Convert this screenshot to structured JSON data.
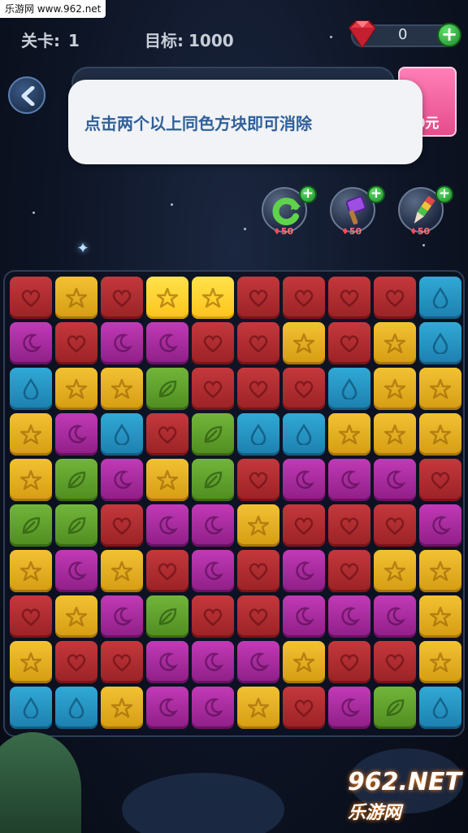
{
  "watermark_top": "乐游网 www.962.net",
  "header": {
    "level_label": "关卡:",
    "level_value": "1",
    "target_label": "目标:",
    "target_value": "1000",
    "gem_count": "0",
    "gem_add": "+"
  },
  "promo": {
    "price_text": "0元"
  },
  "tip": {
    "text": "点击两个以上同色方块即可消除"
  },
  "tools": [
    {
      "name": "refresh",
      "cost": "50",
      "plus": "+"
    },
    {
      "name": "hammer",
      "cost": "50",
      "plus": "+"
    },
    {
      "name": "brush",
      "cost": "50",
      "plus": "+"
    }
  ],
  "board": {
    "rows": [
      [
        "red",
        "yellow",
        "red",
        "yellow-hl",
        "yellow-hl",
        "red",
        "red",
        "red",
        "red",
        "blue"
      ],
      [
        "purple",
        "red",
        "purple",
        "purple",
        "red",
        "red",
        "yellow",
        "red",
        "yellow",
        "blue"
      ],
      [
        "blue",
        "yellow",
        "yellow",
        "green",
        "red",
        "red",
        "red",
        "blue",
        "yellow",
        "yellow"
      ],
      [
        "yellow",
        "purple",
        "blue",
        "red",
        "green",
        "blue",
        "blue",
        "yellow",
        "yellow",
        "yellow"
      ],
      [
        "yellow",
        "green",
        "purple",
        "yellow",
        "green",
        "red",
        "purple",
        "purple",
        "purple",
        "red"
      ],
      [
        "green",
        "green",
        "red",
        "purple",
        "purple",
        "yellow",
        "red",
        "red",
        "red",
        "purple"
      ],
      [
        "yellow",
        "purple",
        "yellow",
        "red",
        "purple",
        "red",
        "purple",
        "red",
        "yellow",
        "yellow"
      ],
      [
        "red",
        "yellow",
        "purple",
        "green",
        "red",
        "red",
        "purple",
        "purple",
        "purple",
        "yellow"
      ],
      [
        "yellow",
        "red",
        "red",
        "purple",
        "purple",
        "purple",
        "yellow",
        "red",
        "red",
        "yellow"
      ],
      [
        "blue",
        "blue",
        "yellow",
        "purple",
        "purple",
        "yellow",
        "red",
        "purple",
        "green",
        "blue"
      ]
    ]
  },
  "colors": {
    "red": "#b02d31",
    "yellow": "#e6b224",
    "purple": "#ab2ca0",
    "green": "#62a32e",
    "blue": "#2798c6",
    "highlight": "#ffd42e"
  },
  "watermark_bottom": {
    "logo": "962",
    "net": ".NET",
    "cn": "乐游网"
  }
}
